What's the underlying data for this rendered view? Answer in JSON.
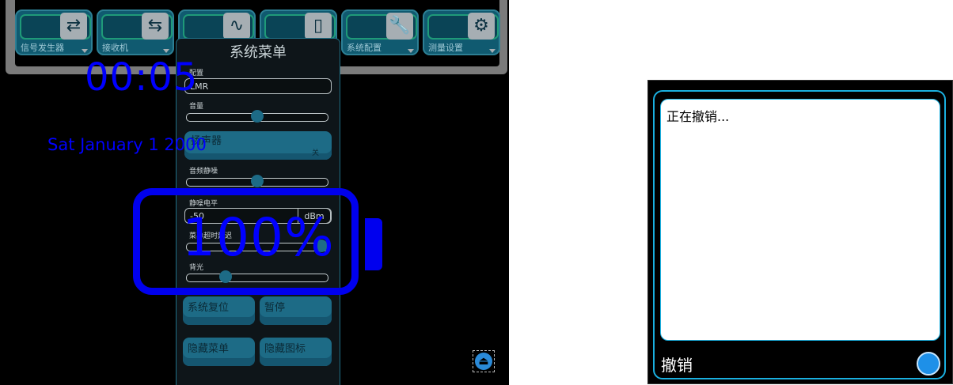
{
  "tabs": [
    {
      "label": "信号发生器",
      "icon": "swap-arrows-icon",
      "glyph": "⇄"
    },
    {
      "label": "接收机",
      "icon": "return-arrows-icon",
      "glyph": "⇆"
    },
    {
      "label": "",
      "icon": "waveform-icon",
      "glyph": "∿"
    },
    {
      "label": "",
      "icon": "meter-icon",
      "glyph": "▯"
    },
    {
      "label": "系统配置",
      "icon": "wrench-icon",
      "glyph": "🔧"
    },
    {
      "label": "测量设置",
      "icon": "gear-icon",
      "glyph": "⚙"
    }
  ],
  "system_menu": {
    "title": "系统菜单",
    "config_label": "配置",
    "config_value": "LMR",
    "volume_label": "音量",
    "volume_level": 0.5,
    "speaker_label": "扬声器",
    "speaker_value": "关",
    "audio_squelch_label": "音频静噪",
    "audio_squelch_level": 0.5,
    "squelch_level_label": "静噪电平",
    "squelch_level_value": "-50",
    "squelch_level_unit": "dBm",
    "menu_timeout_label": "菜单超时延迟",
    "menu_timeout_level": 1.0,
    "backlight_label": "背光",
    "backlight_level": 0.25,
    "system_reset_label": "系统复位",
    "pause_label": "暂停",
    "hide_menu_label": "隐藏菜单",
    "hide_icons_label": "隐藏图标"
  },
  "overlay": {
    "clock": "00:05",
    "date": "Sat January 1 2000",
    "battery_percent": "100%"
  },
  "dialog": {
    "message": "正在撤销...",
    "label": "撤销"
  },
  "colors": {
    "overlay_blue": "#0000ff",
    "accent_teal": "#1d6b86",
    "dialog_border": "#1ab0e0"
  }
}
